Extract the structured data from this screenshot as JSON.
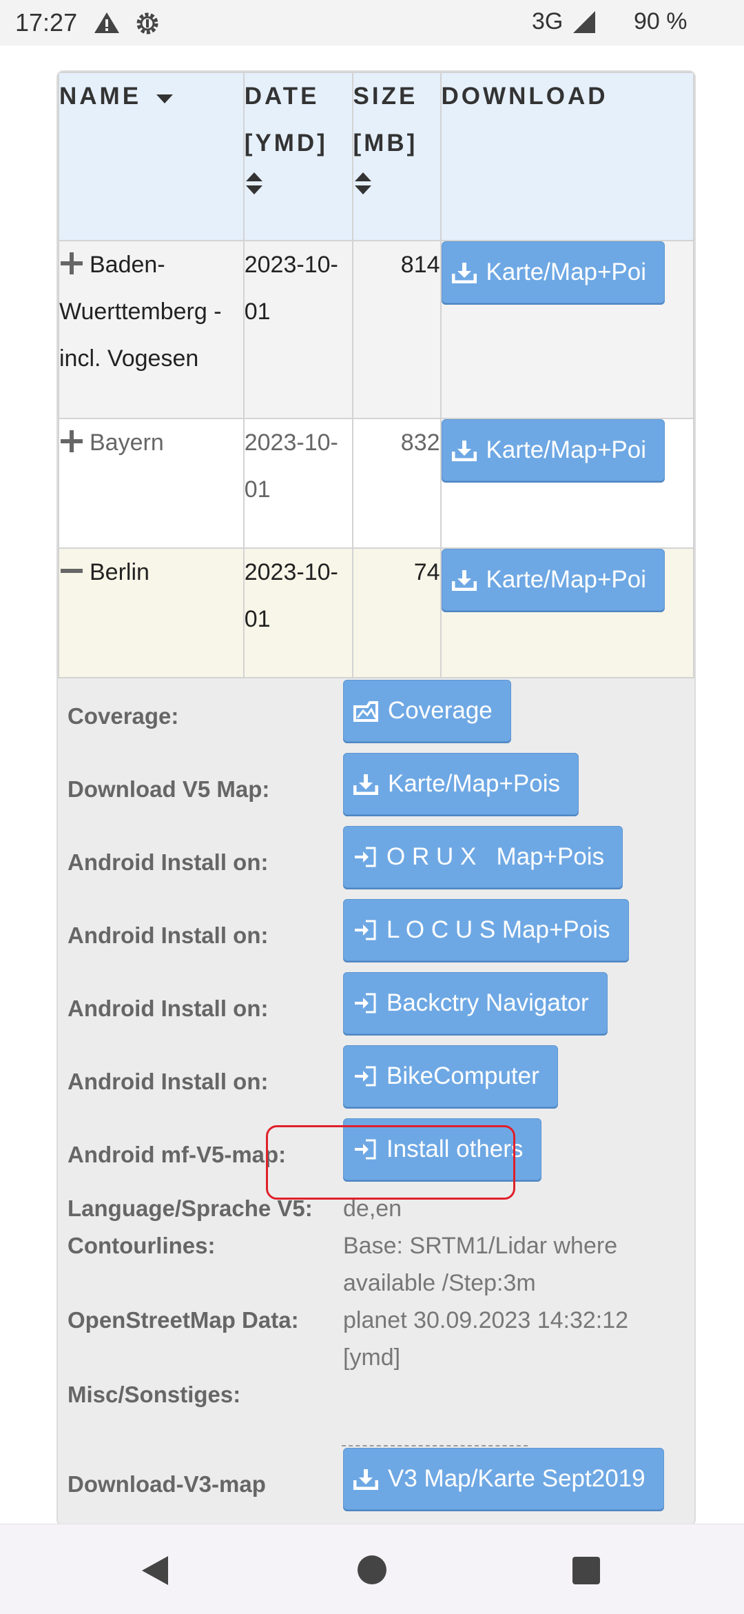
{
  "status_bar": {
    "time": "17:27",
    "network": "3G",
    "battery": "90 %"
  },
  "table": {
    "headers": {
      "name": "NAME",
      "date": "DATE [YMD]",
      "size": "SIZE [MB]",
      "download": "DOWNLOAD"
    },
    "rows": [
      {
        "name": "Baden-Wuerttemberg - incl. Vogesen",
        "date": "2023-10-01",
        "size": "814",
        "button": "Karte/Map+Poi",
        "expanded": false
      },
      {
        "name": "Bayern",
        "date": "2023-10-01",
        "size": "832",
        "button": "Karte/Map+Poi",
        "expanded": false
      },
      {
        "name": "Berlin",
        "date": "2023-10-01",
        "size": "74",
        "button": "Karte/Map+Poi",
        "expanded": true
      }
    ]
  },
  "details": {
    "coverage_label": "Coverage:",
    "coverage_btn": "Coverage",
    "v5map_label": "Download V5 Map:",
    "v5map_btn": "Karte/Map+Pois",
    "android1_label": "Android Install on:",
    "android1_btn": "O R U X   Map+Pois",
    "android2_label": "Android Install on:",
    "android2_btn": "L O C U S Map+Pois",
    "android3_label": "Android Install on:",
    "android3_btn": "Backctry Navigator",
    "android4_label": "Android Install on:",
    "android4_btn": "BikeComputer",
    "mf_label": "Android mf-V5-map:",
    "mf_btn": "Install others",
    "lang_label": "Language/Sprache V5:",
    "lang_value": "de,en",
    "contour_label": "Contourlines:",
    "contour_value": "Base: SRTM1/Lidar where available /Step:3m",
    "osm_label": "OpenStreetMap Data:",
    "osm_value": "planet 30.09.2023 14:32:12 [ymd]",
    "misc_label": "Misc/Sonstiges:",
    "v3_label": "Download-V3-map",
    "v3_btn": "V3 Map/Karte Sept2019"
  },
  "colors": {
    "button": "#6ea8e4",
    "header_bg": "#e6f0fb",
    "highlight": "#e0202a",
    "selected_row": "#f8f6e8"
  }
}
